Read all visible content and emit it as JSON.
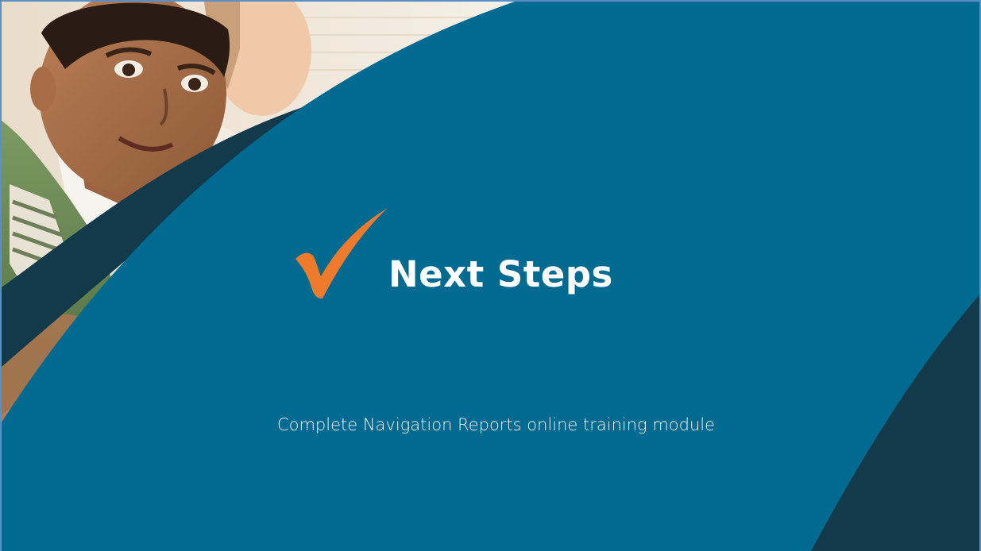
{
  "slide": {
    "title": "Next Steps",
    "subtitle": "Complete Navigation Reports online training module",
    "title_icon": "checkmark-icon",
    "photo": "students-photo"
  },
  "colors": {
    "background_blue": "#006a91",
    "dark_teal": "#123a4b",
    "checkmark_orange": "#ee7a2c",
    "title_text": "#ffffff",
    "frame_border": "#5b8fc7"
  }
}
